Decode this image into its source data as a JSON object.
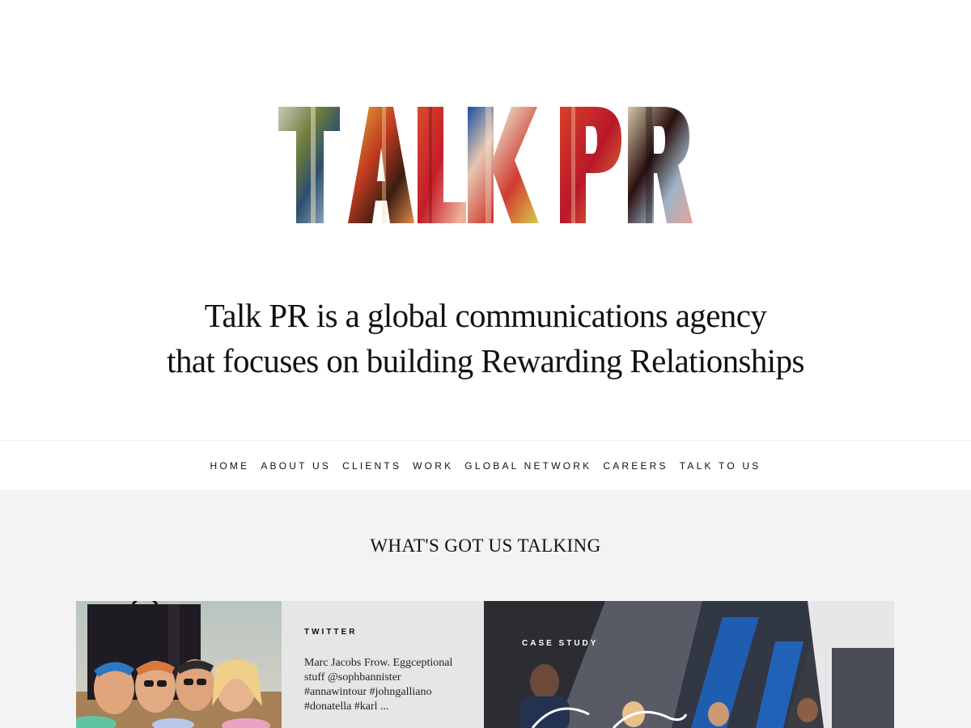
{
  "logo": {
    "text": "TALK PR"
  },
  "tagline": {
    "line1": "Talk PR is a global communications agency",
    "line2": "that focuses on building Rewarding Relationships"
  },
  "nav": {
    "items": [
      "HOME",
      "ABOUT US",
      "CLIENTS",
      "WORK",
      "GLOBAL NETWORK",
      "CAREERS",
      "TALK TO US"
    ]
  },
  "feed": {
    "title": "WHAT'S GOT US TALKING",
    "twitter_card": {
      "label": "TWITTER",
      "text": "Marc Jacobs Frow. Eggceptional stuff @sophbannister #annawintour #johngalliano #donatella #karl ..."
    },
    "case_card": {
      "label": "CASE STUDY"
    }
  },
  "colors": {
    "background": "#ffffff",
    "feed_background": "#f3f3f3",
    "twitter_panel": "#e6e6e6",
    "text": "#111111"
  }
}
